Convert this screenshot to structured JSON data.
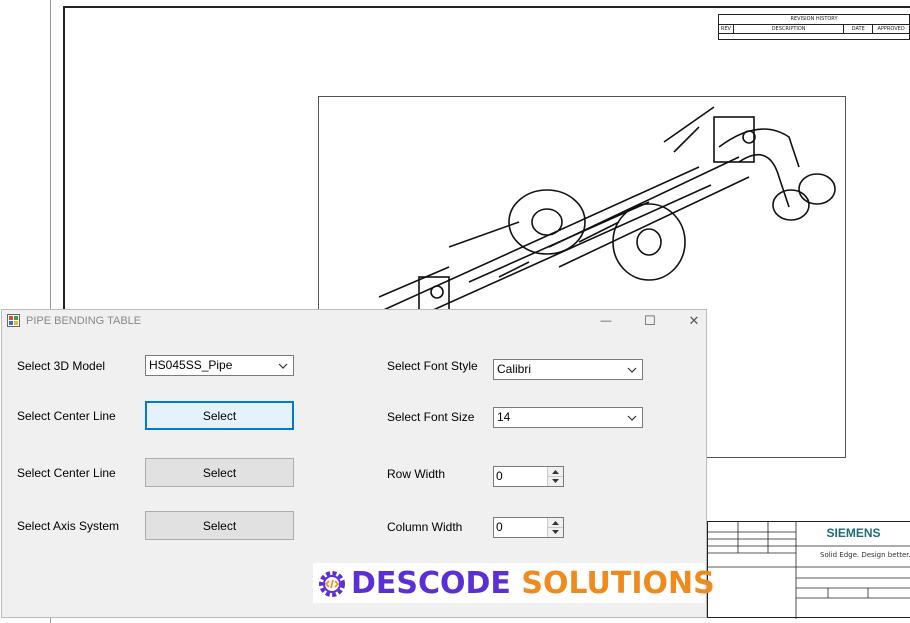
{
  "drawing": {
    "revision_history": "REVISION HISTORY",
    "rev_cols": [
      "REV",
      "DESCRIPTION",
      "DATE",
      "APPROVED"
    ],
    "title_block_brand": "SIEMENS",
    "title_block_tagline": "Solid Edge. Design better."
  },
  "window": {
    "title": "PIPE BENDING TABLE",
    "controls": {
      "minimize": "—",
      "maximize": "☐",
      "close": "✕"
    }
  },
  "form": {
    "model_label": "Select 3D Model",
    "model_value": "HS045SS_Pipe",
    "center_line_1_label": "Select Center Line",
    "center_line_1_button": "Select",
    "center_line_2_label": "Select Center Line",
    "center_line_2_button": "Select",
    "axis_label": "Select Axis System",
    "axis_button": "Select",
    "font_style_label": "Select Font Style",
    "font_style_value": "Calibri",
    "font_size_label": "Select Font Size",
    "font_size_value": "14",
    "row_width_label": "Row Width",
    "row_width_value": "0",
    "column_width_label": "Column Width",
    "column_width_value": "0"
  },
  "watermark": {
    "part1": "DESCODE",
    "part2": "SOLUTIONS"
  },
  "colors": {
    "brand_purple": "#5b2fd6",
    "brand_orange": "#f08a1c",
    "focus_blue": "#0078d7",
    "siemens_teal": "#1e6e78"
  },
  "icons": [
    "app-icon",
    "minimize-icon",
    "maximize-icon",
    "close-icon",
    "chevron-down-icon",
    "spin-up-icon",
    "spin-down-icon",
    "gear-code-icon"
  ]
}
